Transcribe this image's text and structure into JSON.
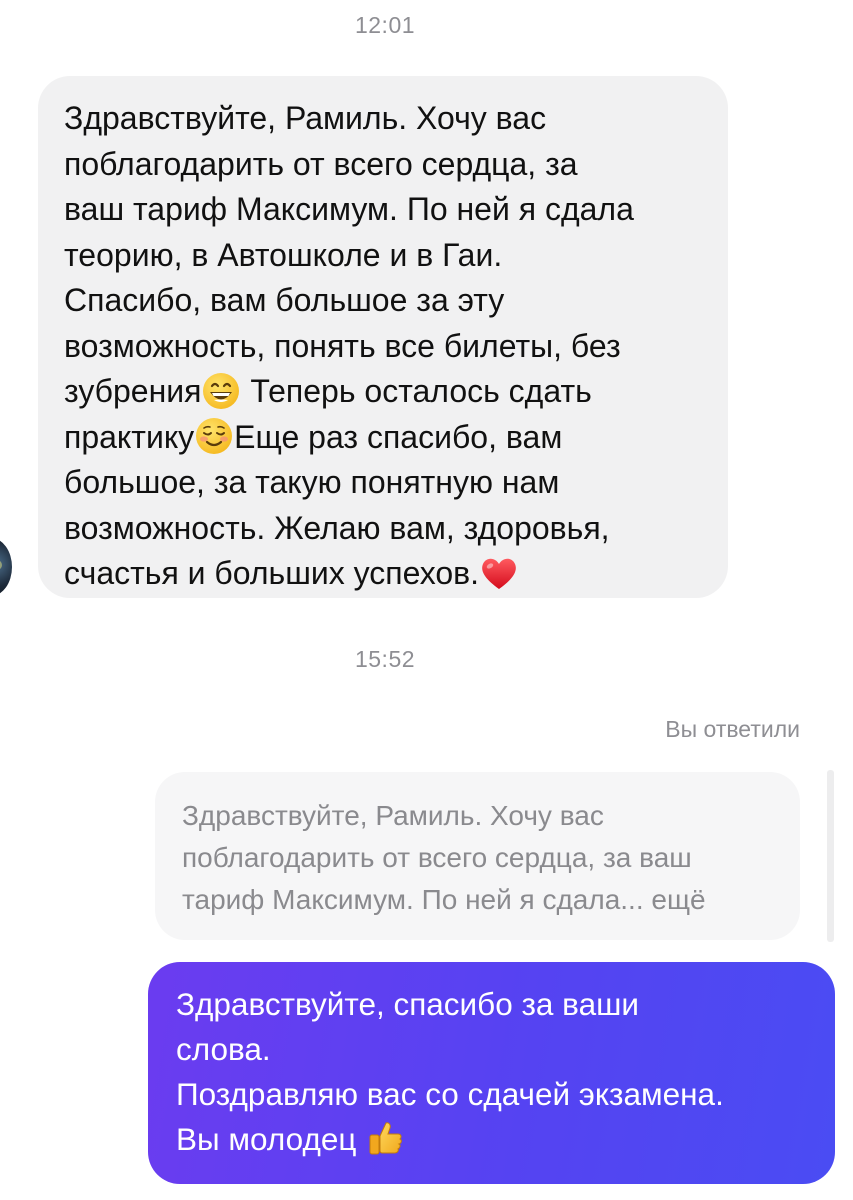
{
  "timestamps": [
    "12:01",
    "15:52"
  ],
  "incoming": {
    "lines": [
      "Здравствуйте, Рамиль. Хочу вас",
      "поблагодарить от всего сердца, за",
      "ваш тариф Максимум. По ней я сдала",
      "теорию, в Автошколе  и в Гаи.",
      "Спасибо, вам большое за эту",
      "возможность, понять все билеты, без",
      "зубрения",
      " Теперь осталось сдать",
      "практику",
      "Еще раз спасибо, вам",
      "большое, за такую понятную нам",
      "возможность. Желаю вам, здоровья,",
      "счастья и больших успехов."
    ],
    "emojis": [
      "grinning-face-emoji",
      "smiling-face-emoji",
      "red-heart-emoji"
    ]
  },
  "reply": {
    "label": "Вы ответили",
    "quoted_lines": [
      "Здравствуйте, Рамиль. Хочу вас",
      "поблагодарить от всего сердца, за ваш",
      "тариф Максимум. По ней я сдала... ещё"
    ]
  },
  "outgoing": {
    "lines": [
      "Здравствуйте, спасибо за ваши",
      "слова.",
      "Поздравляю вас со сдачей экзамена.",
      "Вы молодец "
    ],
    "emoji": "thumbs-up-emoji"
  },
  "colors": {
    "incoming_bubble": "#f1f1f2",
    "outgoing_bubble_start": "#6b3cf0",
    "outgoing_bubble_end": "#4a4cf3",
    "timestamp": "#8e8e93"
  }
}
